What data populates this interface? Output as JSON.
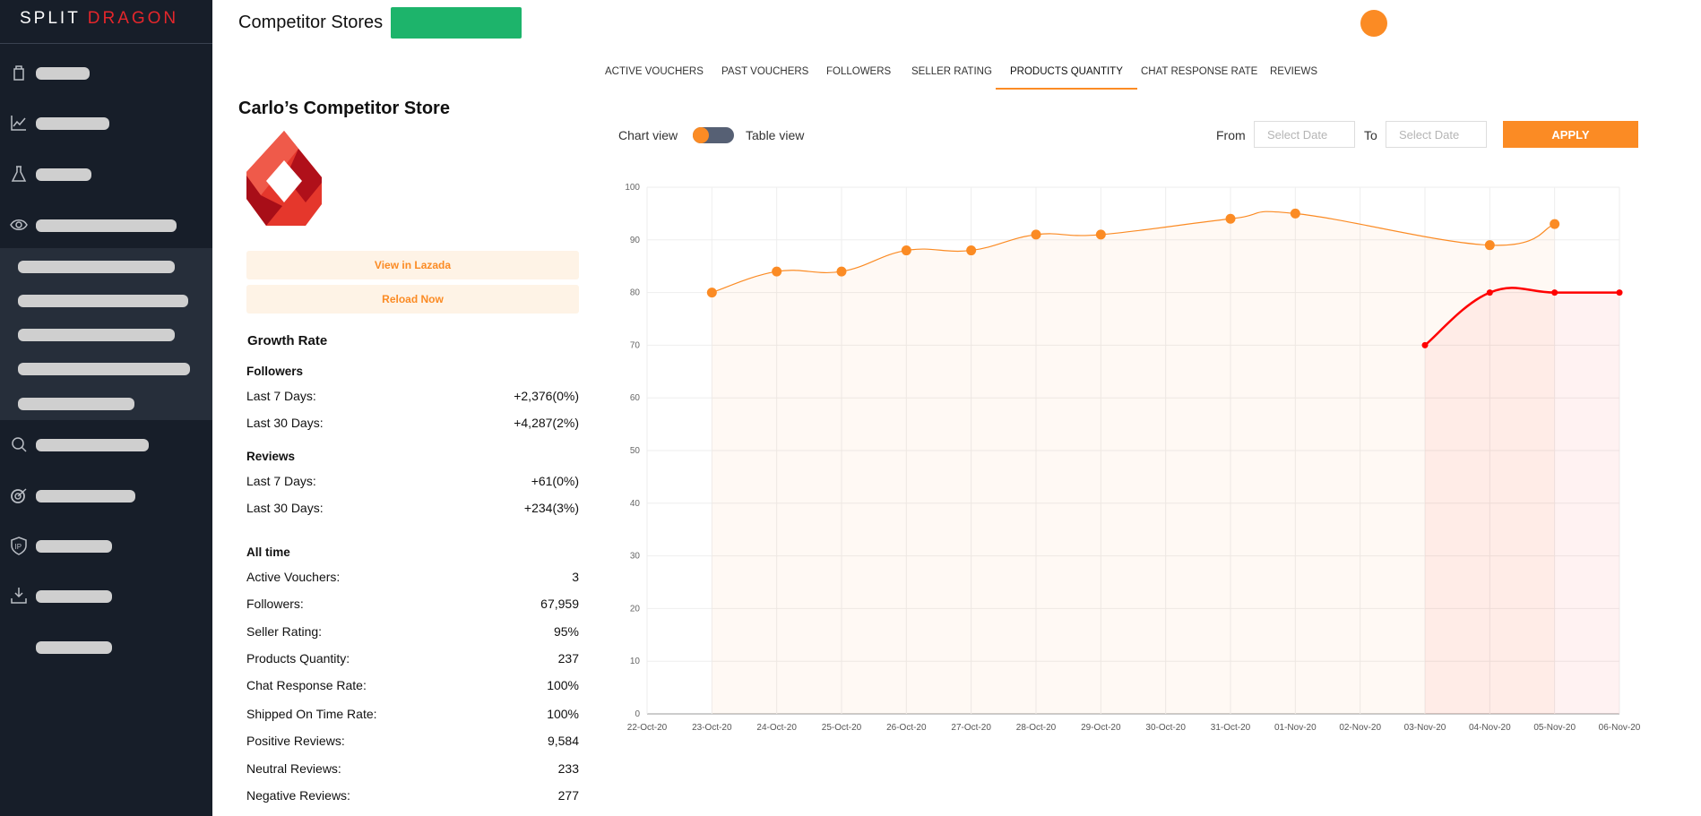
{
  "brand": {
    "part1": "SPLIT",
    "part2": "DRAGON"
  },
  "header": {
    "title": "Competitor Stores"
  },
  "sidebar": {
    "icons": [
      "shopping-bag-icon",
      "chart-line-icon",
      "flask-icon",
      "eye-icon",
      "search-icon",
      "target-icon",
      "ip-shield-icon",
      "download-icon"
    ]
  },
  "tabs": [
    "Active Vouchers",
    "Past Vouchers",
    "Followers",
    "Seller Rating",
    "Products Quantity",
    "Chat Response Rate",
    "Reviews"
  ],
  "active_tab": "Products Quantity",
  "store": {
    "name": "Carlo’s Competitor Store",
    "view_button": "View in Lazada",
    "reload_button": "Reload Now"
  },
  "growth": {
    "title": "Growth Rate",
    "followers": {
      "title": "Followers",
      "rows": [
        {
          "label": "Last 7 Days:",
          "value": "+2,376(0%)"
        },
        {
          "label": "Last 30 Days:",
          "value": "+4,287(2%)"
        }
      ]
    },
    "reviews": {
      "title": "Reviews",
      "rows": [
        {
          "label": "Last 7 Days:",
          "value": "+61(0%)"
        },
        {
          "label": "Last 30 Days:",
          "value": "+234(3%)"
        }
      ]
    }
  },
  "alltime": {
    "title": "All time",
    "rows": [
      {
        "label": "Active Vouchers:",
        "value": "3"
      },
      {
        "label": "Followers:",
        "value": "67,959"
      },
      {
        "label": "Seller Rating:",
        "value": "95%"
      },
      {
        "label": "Products Quantity:",
        "value": "237"
      },
      {
        "label": "Chat Response Rate:",
        "value": "100%"
      },
      {
        "label": "Shipped On Time Rate:",
        "value": "100%"
      },
      {
        "label": "Positive Reviews:",
        "value": "9,584"
      },
      {
        "label": "Neutral Reviews:",
        "value": "233"
      },
      {
        "label": "Negative Reviews:",
        "value": "277"
      }
    ]
  },
  "controls": {
    "chart_view": "Chart view",
    "table_view": "Table view",
    "from": "From",
    "to": "To",
    "date_placeholder": "Select Date",
    "apply": "APPLY"
  },
  "colors": {
    "accent": "#fb8b24",
    "green": "#1db46b",
    "red_series": "#ff0000",
    "sidebar": "#171e29"
  },
  "chart_data": {
    "type": "line",
    "ylim": [
      0,
      100
    ],
    "yticks": [
      0,
      10,
      20,
      30,
      40,
      50,
      60,
      70,
      80,
      90,
      100
    ],
    "grid": true,
    "categories": [
      "22-Oct-20",
      "23-Oct-20",
      "24-Oct-20",
      "25-Oct-20",
      "26-Oct-20",
      "27-Oct-20",
      "28-Oct-20",
      "29-Oct-20",
      "30-Oct-20",
      "31-Oct-20",
      "01-Nov-20",
      "02-Nov-20",
      "03-Nov-20",
      "04-Nov-20",
      "05-Nov-20",
      "06-Nov-20"
    ],
    "series": [
      {
        "color": "#fb8b24",
        "values": [
          null,
          80,
          84,
          84,
          88,
          88,
          91,
          91,
          null,
          94,
          95,
          null,
          null,
          89,
          93,
          null
        ]
      },
      {
        "color": "#ff0000",
        "values": [
          null,
          null,
          null,
          null,
          null,
          null,
          null,
          null,
          null,
          null,
          null,
          null,
          70,
          80,
          80,
          80
        ]
      }
    ]
  }
}
